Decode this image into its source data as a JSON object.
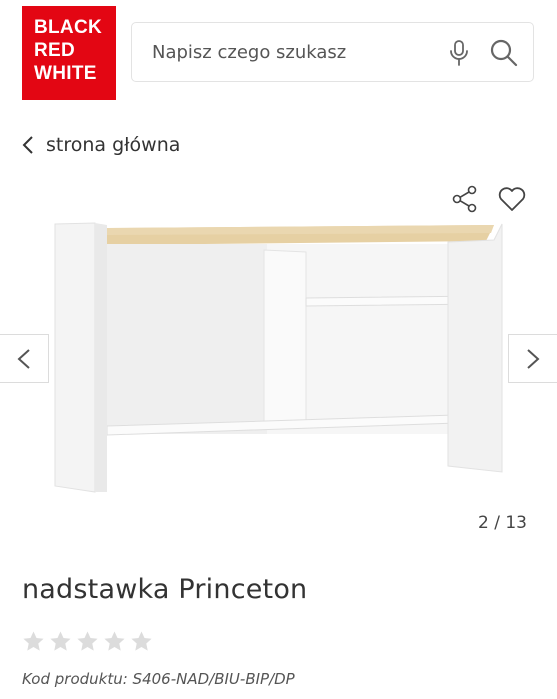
{
  "header": {
    "logo_lines": [
      "BLACK",
      "RED",
      "WHITE"
    ],
    "brand_color": "#e30613",
    "search_placeholder": "Napisz czego szukasz",
    "icons": [
      "microphone-icon",
      "search-icon"
    ]
  },
  "breadcrumb": {
    "label": "strona główna"
  },
  "gallery": {
    "counter": "2 / 13",
    "actions": [
      "share-icon",
      "heart-icon"
    ],
    "nav": [
      "chevron-left-icon",
      "chevron-right-icon"
    ]
  },
  "product": {
    "title": "nadstawka Princeton",
    "rating": 0,
    "max_rating": 5,
    "code": "Kod produktu: S406-NAD/BIU-BIP/DP"
  }
}
